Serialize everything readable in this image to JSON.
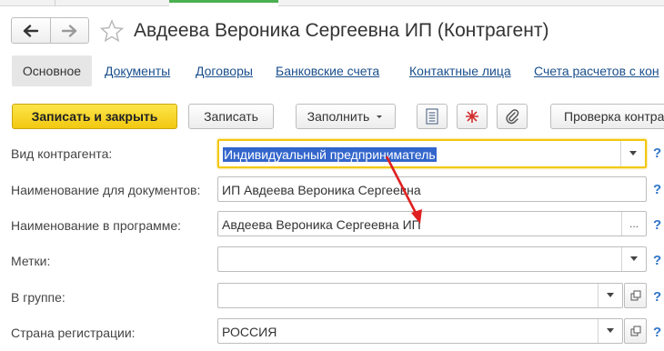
{
  "header": {
    "title": "Авдеева Вероника Сергеевна ИП (Контрагент)",
    "back_icon": "arrow-left-icon",
    "forward_icon": "arrow-right-icon",
    "favorite_icon": "star-outline-icon"
  },
  "tabs": [
    {
      "label": "Основное",
      "active": true
    },
    {
      "label": "Документы"
    },
    {
      "label": "Договоры"
    },
    {
      "label": "Банковские счета"
    },
    {
      "label": "Контактные лица"
    },
    {
      "label": "Счета расчетов с кон"
    }
  ],
  "toolbar": {
    "save_close": "Записать и закрыть",
    "save": "Записать",
    "fill": "Заполнить",
    "fill_icon": "chevron-down-icon",
    "report_icon": "document-list-icon",
    "structure_icon": "structure-icon",
    "attach_icon": "paperclip-icon",
    "check": "Проверка контра"
  },
  "form": {
    "kind": {
      "label": "Вид контрагента:",
      "value": "Индивидуальный предприниматель",
      "help": "?"
    },
    "doc_name": {
      "label": "Наименование для документов:",
      "value": "ИП Авдеева Вероника Сергеевна",
      "help": "?"
    },
    "prog_name": {
      "label": "Наименование в программе:",
      "value": "Авдеева Вероника Сергеевна ИП",
      "button": "...",
      "help": "?"
    },
    "tags": {
      "label": "Метки:",
      "value": "",
      "help": "?"
    },
    "group": {
      "label": "В группе:",
      "value": "",
      "help": "?"
    },
    "country": {
      "label": "Страна регистрации:",
      "value": "РОССИЯ",
      "help": "?"
    }
  },
  "colors": {
    "accent": "#f2c811",
    "link": "#1a4f8c",
    "annotation_arrow": "#e02020",
    "selection": "#3366cc"
  }
}
